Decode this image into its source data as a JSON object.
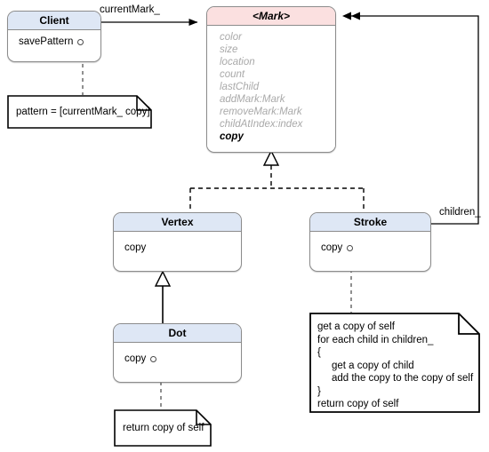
{
  "diagram": {
    "title": "Prototype pattern UML class diagram",
    "colors": {
      "header_blue": "#dee7f5",
      "header_pink": "#fbe0e0",
      "border_gray": "#8c8c8c",
      "abstract_text": "#a9a9a9",
      "line": "#000000"
    }
  },
  "classes": {
    "client": {
      "name": "Client",
      "members": [
        {
          "text": "savePattern",
          "style": "plain",
          "lollipop": true
        }
      ]
    },
    "mark": {
      "name": "<Mark>",
      "members": [
        {
          "text": "color",
          "style": "abstract"
        },
        {
          "text": "size",
          "style": "abstract"
        },
        {
          "text": "location",
          "style": "abstract"
        },
        {
          "text": "count",
          "style": "abstract"
        },
        {
          "text": "lastChild",
          "style": "abstract"
        },
        {
          "text": "addMark:Mark",
          "style": "abstract"
        },
        {
          "text": "removeMark:Mark",
          "style": "abstract"
        },
        {
          "text": "childAtIndex:index",
          "style": "abstract"
        },
        {
          "text": "copy",
          "style": "strong"
        }
      ]
    },
    "vertex": {
      "name": "Vertex",
      "members": [
        {
          "text": "copy",
          "style": "plain",
          "lollipop": false
        }
      ]
    },
    "stroke": {
      "name": "Stroke",
      "members": [
        {
          "text": "copy",
          "style": "plain",
          "lollipop": true
        }
      ]
    },
    "dot": {
      "name": "Dot",
      "members": [
        {
          "text": "copy",
          "style": "plain",
          "lollipop": true
        }
      ]
    }
  },
  "notes": {
    "client_note": {
      "text": "pattern = [currentMark_ copy]"
    },
    "dot_note": {
      "text": "return copy of self"
    },
    "stroke_note": {
      "text": "get a copy of self\nfor each child in children_\n{\n     get a copy of child\n     add the copy to the copy of self\n}\nreturn copy of self"
    }
  },
  "edges": {
    "current_mark_label": "currentMark_",
    "children_label": "children_"
  }
}
